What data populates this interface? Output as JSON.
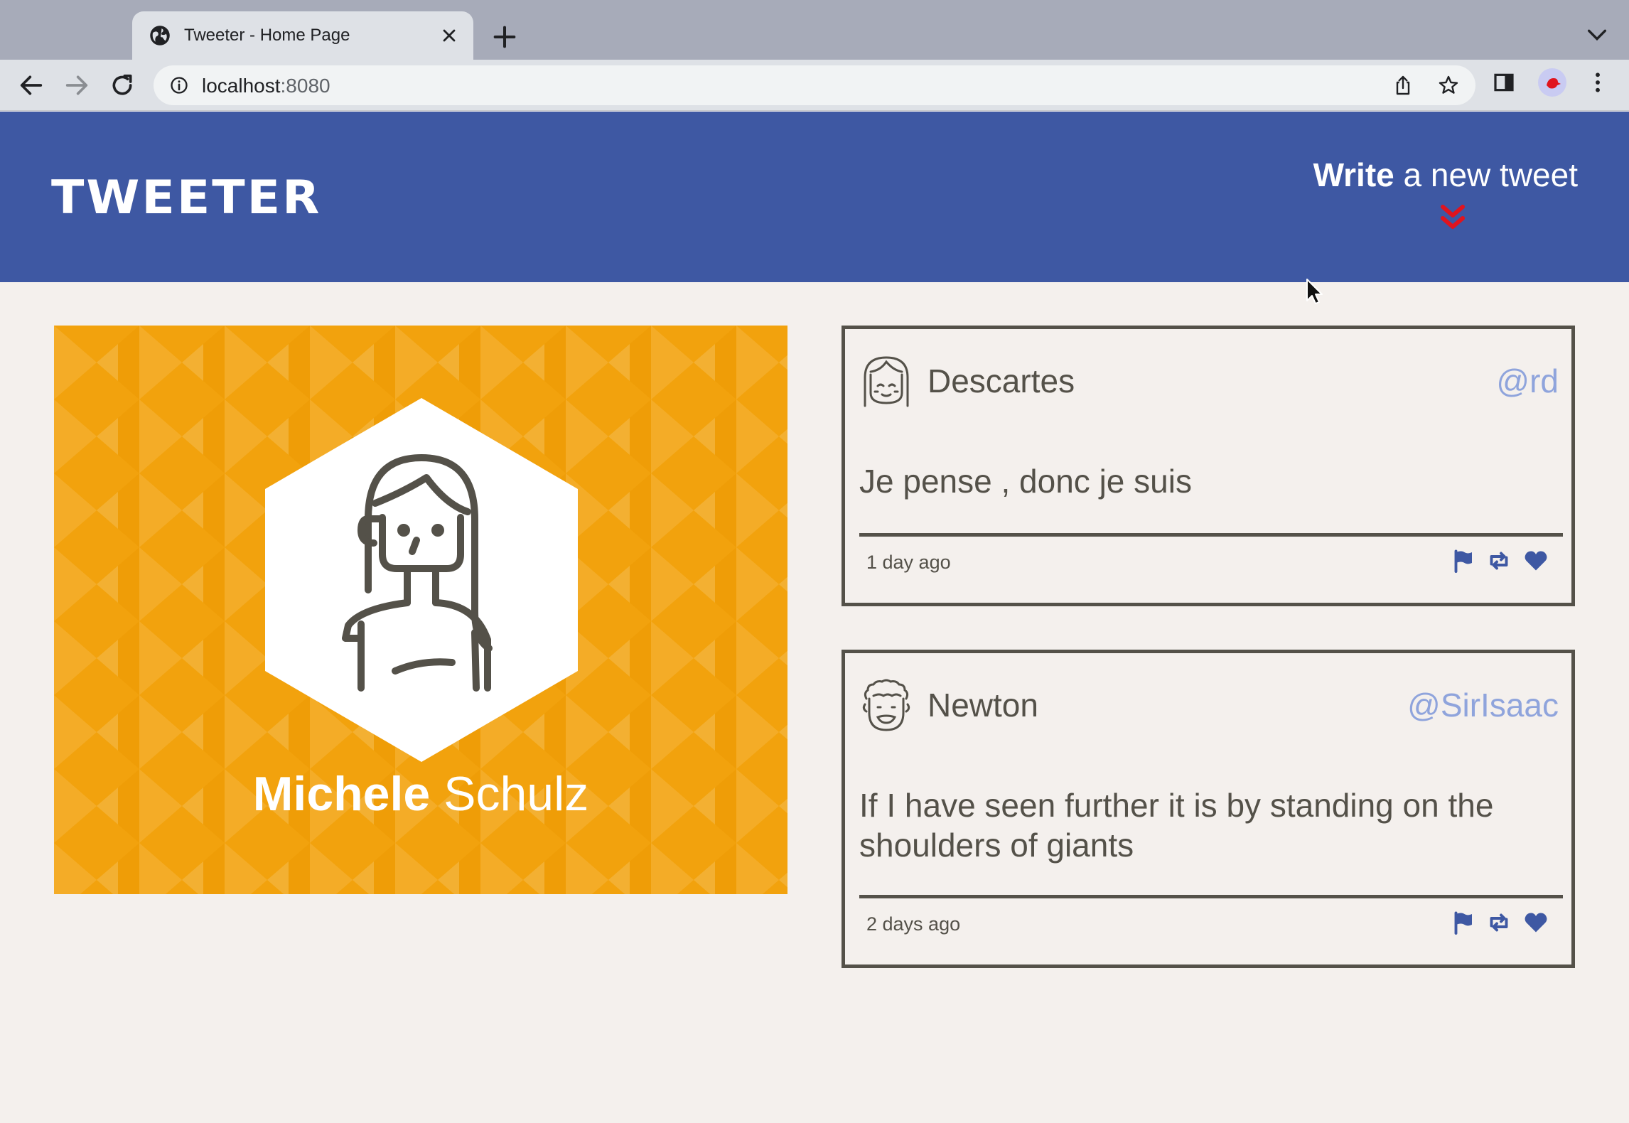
{
  "browser": {
    "tab_title": "Tweeter - Home Page",
    "url_host": "localhost",
    "url_port": ":8080"
  },
  "header": {
    "logo": "TWEETER",
    "compose_bold": "Write",
    "compose_rest": " a new tweet",
    "compose_arrow_color": "#e0141e",
    "background": "#3e58a3"
  },
  "profile": {
    "first_name": "Michele",
    "last_name": "Schulz",
    "card_color": "#f2a20d"
  },
  "tweets": [
    {
      "name": "Descartes",
      "handle": "@rd",
      "text": "Je pense , donc je suis",
      "time": "1 day ago",
      "avatar_icon": "girl-avatar-icon"
    },
    {
      "name": "Newton",
      "handle": "@SirIsaac",
      "text": "If I have seen further it is by standing on the shoulders of giants",
      "time": "2 days ago",
      "avatar_icon": "curly-hair-avatar-icon"
    }
  ],
  "colors": {
    "ink": "#545149",
    "handle": "#8fa4dc",
    "action_icon": "#3e58a3",
    "page_bg": "#f4f0ed"
  }
}
